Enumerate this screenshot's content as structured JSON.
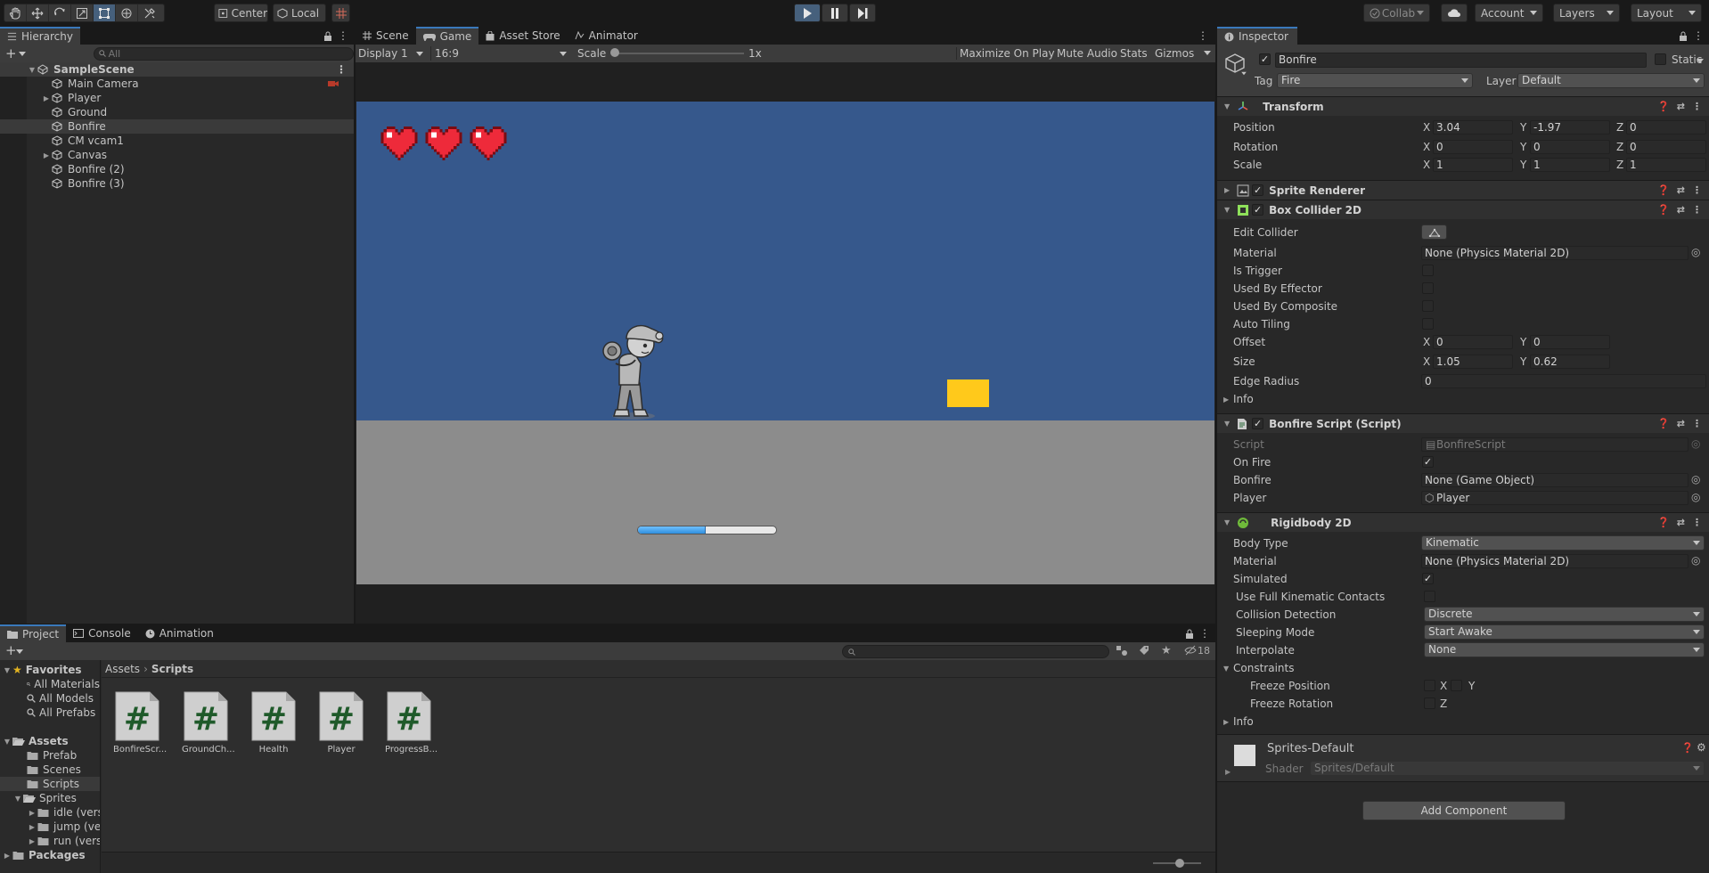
{
  "toolbar": {
    "pivot_label": "Center",
    "space_label": "Local",
    "collab_label": "Collab",
    "account_label": "Account",
    "layers_label": "Layers",
    "layout_label": "Layout"
  },
  "hierarchy": {
    "tab_label": "Hierarchy",
    "search_placeholder": "All",
    "scene_name": "SampleScene",
    "items": [
      {
        "label": "Main Camera"
      },
      {
        "label": "Player"
      },
      {
        "label": "Ground"
      },
      {
        "label": "Bonfire"
      },
      {
        "label": "CM vcam1"
      },
      {
        "label": "Canvas"
      },
      {
        "label": "Bonfire (2)"
      },
      {
        "label": "Bonfire (3)"
      }
    ]
  },
  "center_tabs": [
    {
      "label": "Scene"
    },
    {
      "label": "Game"
    },
    {
      "label": "Asset Store"
    },
    {
      "label": "Animator"
    }
  ],
  "game_bar": {
    "display": "Display 1",
    "aspect": "16:9",
    "scale_label": "Scale",
    "scale_value": "1x",
    "maximize": "Maximize On Play",
    "mute": "Mute Audio",
    "stats": "Stats",
    "gizmos": "Gizmos"
  },
  "game": {
    "hearts": 3,
    "progress": 0.49,
    "sky_color": "#36588c",
    "ground_color": "#8c8c8c",
    "block_color": "#ffc91b"
  },
  "bottom": {
    "tabs": [
      {
        "label": "Project"
      },
      {
        "label": "Console"
      },
      {
        "label": "Animation"
      }
    ],
    "count": "18",
    "favorites": "Favorites",
    "fav_items": [
      {
        "label": "All Materials"
      },
      {
        "label": "All Models"
      },
      {
        "label": "All Prefabs"
      }
    ],
    "assets": "Assets",
    "asset_items": [
      {
        "label": "Prefab"
      },
      {
        "label": "Scenes"
      },
      {
        "label": "Scripts"
      },
      {
        "label": "Sprites"
      }
    ],
    "sprite_items": [
      {
        "label": "idle (versa"
      },
      {
        "label": "jump (vers"
      },
      {
        "label": "run (versa"
      }
    ],
    "packages": "Packages",
    "breadcrumb": [
      "Assets",
      "Scripts"
    ],
    "files": [
      {
        "label": "BonfireScr..."
      },
      {
        "label": "GroundCh..."
      },
      {
        "label": "Health"
      },
      {
        "label": "Player"
      },
      {
        "label": "ProgressB..."
      }
    ]
  },
  "inspector": {
    "tab_label": "Inspector",
    "object_name": "Bonfire",
    "static_label": "Static",
    "tag_label": "Tag",
    "tag_value": "Fire",
    "layer_label": "Layer",
    "layer_value": "Default",
    "transform": {
      "title": "Transform",
      "position_label": "Position",
      "rotation_label": "Rotation",
      "scale_label": "Scale",
      "pos": {
        "x": "3.04",
        "y": "-1.97",
        "z": "0"
      },
      "rot": {
        "x": "0",
        "y": "0",
        "z": "0"
      },
      "scl": {
        "x": "1",
        "y": "1",
        "z": "1"
      }
    },
    "sprite_renderer": "Sprite Renderer",
    "box_collider": {
      "title": "Box Collider 2D",
      "edit_collider": "Edit Collider",
      "material_label": "Material",
      "material_value": "None (Physics Material 2D)",
      "is_trigger": "Is Trigger",
      "used_by_effector": "Used By Effector",
      "used_by_composite": "Used By Composite",
      "auto_tiling": "Auto Tiling",
      "offset_label": "Offset",
      "offset": {
        "x": "0",
        "y": "0"
      },
      "size_label": "Size",
      "size": {
        "x": "1.05",
        "y": "0.62"
      },
      "edge_radius_label": "Edge Radius",
      "edge_radius": "0",
      "info": "Info"
    },
    "bonfire_script": {
      "title": "Bonfire Script (Script)",
      "script_label": "Script",
      "script_value": "BonfireScript",
      "on_fire_label": "On Fire",
      "bonfire_label": "Bonfire",
      "bonfire_value": "None (Game Object)",
      "player_label": "Player",
      "player_value": "Player"
    },
    "rigidbody": {
      "title": "Rigidbody 2D",
      "body_type_label": "Body Type",
      "body_type": "Kinematic",
      "material_label": "Material",
      "material_value": "None (Physics Material 2D)",
      "simulated_label": "Simulated",
      "full_kinematic_label": "Use Full Kinematic Contacts",
      "collision_label": "Collision Detection",
      "collision_value": "Discrete",
      "sleeping_label": "Sleeping Mode",
      "sleeping_value": "Start Awake",
      "interpolate_label": "Interpolate",
      "interpolate_value": "None",
      "constraints_label": "Constraints",
      "freeze_pos_label": "Freeze Position",
      "freeze_rot_label": "Freeze Rotation",
      "x": "X",
      "y": "Y",
      "z": "Z",
      "info": "Info"
    },
    "material": {
      "name": "Sprites-Default",
      "shader_label": "Shader",
      "shader_value": "Sprites/Default"
    },
    "add_component": "Add Component"
  }
}
